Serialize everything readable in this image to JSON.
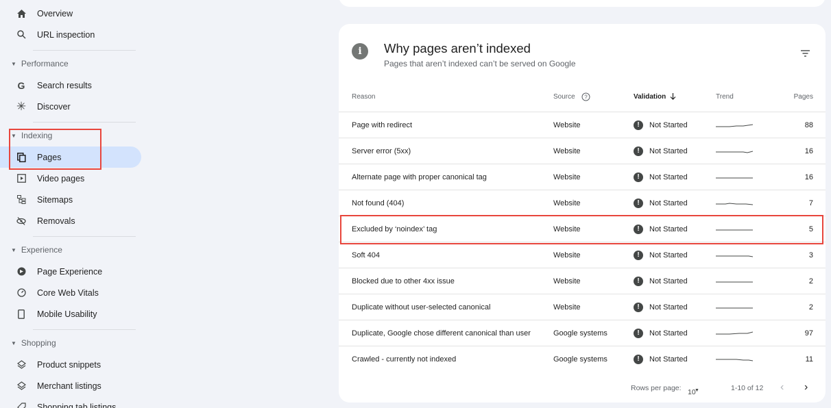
{
  "sidebar": {
    "overview": "Overview",
    "url_inspection": "URL inspection",
    "sections": {
      "performance": "Performance",
      "indexing": "Indexing",
      "experience": "Experience",
      "shopping": "Shopping"
    },
    "items": {
      "search_results": "Search results",
      "discover": "Discover",
      "pages": "Pages",
      "video_pages": "Video pages",
      "sitemaps": "Sitemaps",
      "removals": "Removals",
      "page_experience": "Page Experience",
      "core_web_vitals": "Core Web Vitals",
      "mobile_usability": "Mobile Usability",
      "product_snippets": "Product snippets",
      "merchant_listings": "Merchant listings",
      "shopping_tab_listings": "Shopping tab listings"
    }
  },
  "card": {
    "title": "Why pages aren’t indexed",
    "subtitle": "Pages that aren’t indexed can’t be served on Google",
    "columns": {
      "reason": "Reason",
      "source": "Source",
      "validation": "Validation",
      "trend": "Trend",
      "pages": "Pages"
    },
    "rows": [
      {
        "reason": "Page with redirect",
        "source": "Website",
        "validation": "Not Started",
        "pages": "88"
      },
      {
        "reason": "Server error (5xx)",
        "source": "Website",
        "validation": "Not Started",
        "pages": "16"
      },
      {
        "reason": "Alternate page with proper canonical tag",
        "source": "Website",
        "validation": "Not Started",
        "pages": "16"
      },
      {
        "reason": "Not found (404)",
        "source": "Website",
        "validation": "Not Started",
        "pages": "7"
      },
      {
        "reason": "Excluded by ‘noindex’ tag",
        "source": "Website",
        "validation": "Not Started",
        "pages": "5"
      },
      {
        "reason": "Soft 404",
        "source": "Website",
        "validation": "Not Started",
        "pages": "3"
      },
      {
        "reason": "Blocked due to other 4xx issue",
        "source": "Website",
        "validation": "Not Started",
        "pages": "2"
      },
      {
        "reason": "Duplicate without user-selected canonical",
        "source": "Website",
        "validation": "Not Started",
        "pages": "2"
      },
      {
        "reason": "Duplicate, Google chose different canonical than user",
        "source": "Google systems",
        "validation": "Not Started",
        "pages": "97"
      },
      {
        "reason": "Crawled - currently not indexed",
        "source": "Google systems",
        "validation": "Not Started",
        "pages": "11"
      }
    ],
    "footer": {
      "rows_per_page_label": "Rows per page:",
      "rows_per_page_value": "10",
      "range": "1-10 of 12"
    }
  },
  "colors": {
    "highlight_box": "#e8453c",
    "active_nav": "#d3e3fd"
  }
}
